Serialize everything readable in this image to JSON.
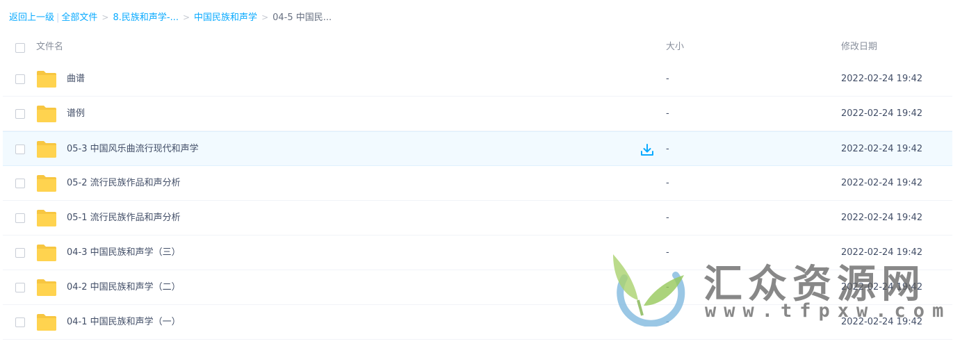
{
  "breadcrumb": {
    "back": "返回上一级",
    "all_files": "全部文件",
    "crumbs": [
      "8.民族和声学-...",
      "中国民族和声学"
    ],
    "current": "04-5 中国民..."
  },
  "columns": {
    "name": "文件名",
    "size": "大小",
    "date": "修改日期"
  },
  "files": [
    {
      "name": "曲谱",
      "size": "-",
      "date": "2022-02-24 19:42"
    },
    {
      "name": "谱例",
      "size": "-",
      "date": "2022-02-24 19:42"
    },
    {
      "name": "05-3 中国风乐曲流行现代和声学",
      "size": "-",
      "date": "2022-02-24 19:42"
    },
    {
      "name": "05-2 流行民族作品和声分析",
      "size": "-",
      "date": "2022-02-24 19:42"
    },
    {
      "name": "05-1 流行民族作品和声分析",
      "size": "-",
      "date": "2022-02-24 19:42"
    },
    {
      "name": "04-3 中国民族和声学（三）",
      "size": "-",
      "date": "2022-02-24 19:42"
    },
    {
      "name": "04-2 中国民族和声学（二）",
      "size": "-",
      "date": "2022-02-24 19:42"
    },
    {
      "name": "04-1 中国民族和声学（一）",
      "size": "-",
      "date": "2022-02-24 19:42"
    }
  ],
  "watermark": {
    "title": "汇众资源网",
    "url": "www.tfpxw.com"
  },
  "colors": {
    "link": "#09aaff",
    "folder": "#ffd34f",
    "folder_tab": "#f7c641",
    "hover_row": "#f2faff",
    "download_icon": "#09aaff"
  },
  "icons": {
    "folder": "folder-icon",
    "download": "download-icon",
    "checkbox": "checkbox"
  }
}
